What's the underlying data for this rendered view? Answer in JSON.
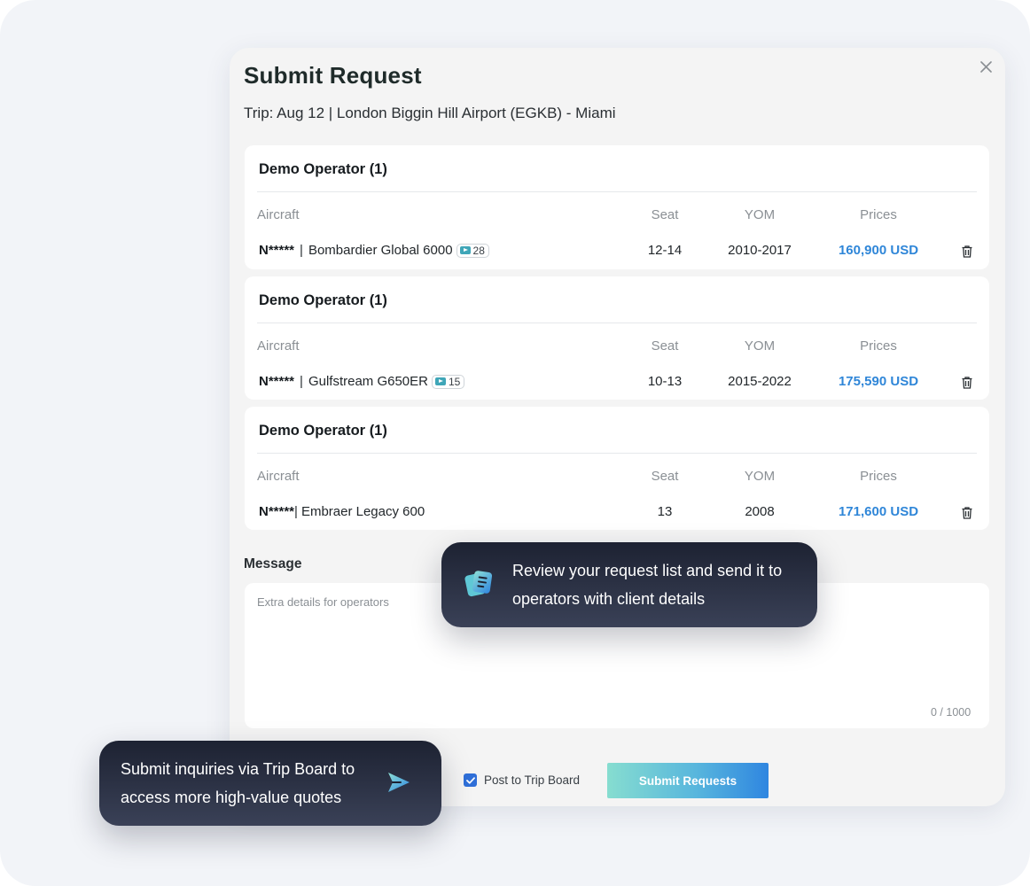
{
  "modal": {
    "title": "Submit Request",
    "trip_line": "Trip: Aug 12 | London Biggin Hill Airport (EGKB) - Miami"
  },
  "table_headers": {
    "aircraft": "Aircraft",
    "seat": "Seat",
    "yom": "YOM",
    "prices": "Prices"
  },
  "cards": [
    {
      "operator": "Demo Operator (1)",
      "registration": "N*****",
      "separator": "|",
      "aircraft": "Bombardier Global 6000",
      "badge_count": "28",
      "seat": "12-14",
      "yom": "2010-2017",
      "price": "160,900 USD"
    },
    {
      "operator": "Demo Operator (1)",
      "registration": "N*****",
      "separator": "|",
      "aircraft": "Gulfstream G650ER",
      "badge_count": "15",
      "seat": "10-13",
      "yom": "2015-2022",
      "price": "175,590 USD"
    },
    {
      "operator": "Demo Operator (1)",
      "registration": "N*****",
      "separator": "|",
      "aircraft": "Embraer Legacy 600",
      "badge_count": null,
      "seat": "13",
      "yom": "2008",
      "price": "171,600 USD"
    }
  ],
  "message": {
    "label": "Message",
    "placeholder": "Extra details for operators",
    "value": "",
    "counter": "0 / 1000"
  },
  "footer": {
    "post_to_trip_board_label": "Post to Trip Board",
    "post_to_trip_board_checked": true,
    "submit_label": "Submit Requests"
  },
  "tooltips": {
    "review": {
      "line1": "Review your request list and send it to",
      "line2": "operators with client details",
      "icon": "request-list-icon"
    },
    "trip_board": {
      "line1": "Submit inquiries via Trip Board to",
      "line2": "access more high-value quotes",
      "icon": "send-arrow-icon"
    }
  },
  "colors": {
    "price": "#2f86d8",
    "checkbox": "#2f6fd8",
    "tooltip_bg": "#262b3d",
    "submit_gradient_start": "#86ddd0",
    "submit_gradient_end": "#2f86e0"
  }
}
